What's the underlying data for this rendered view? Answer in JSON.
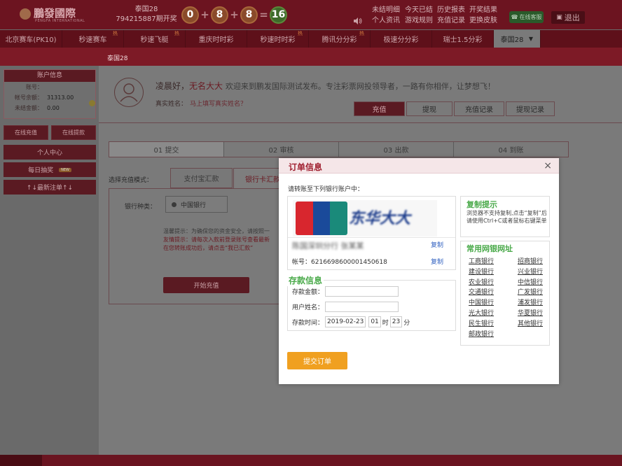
{
  "header": {
    "logo": "鵬發國際",
    "logo_sub": "PENGFA INTERNATIONAL",
    "lottery_name": "泰国28",
    "issue": "794215887期开奖",
    "balls": [
      "0",
      "8",
      "8"
    ],
    "ops": [
      "+",
      "+",
      "="
    ],
    "sum": "16",
    "links": [
      "未结明细",
      "个人资讯",
      "今天已结",
      "游戏规则",
      "历史报表",
      "充值记录",
      "开奖结果",
      "更换皮肤"
    ],
    "service": "在线客服",
    "exit": "退出"
  },
  "gamenav": [
    {
      "label": "北京赛车(PK10)",
      "hot": ""
    },
    {
      "label": "秒速赛车",
      "hot": "热"
    },
    {
      "label": "秒速飞艇",
      "hot": "热"
    },
    {
      "label": "重庆时时彩",
      "hot": ""
    },
    {
      "label": "秒速时时彩",
      "hot": "热"
    },
    {
      "label": "腾讯分分彩",
      "hot": "热"
    },
    {
      "label": "极速分分彩",
      "hot": ""
    },
    {
      "label": "瑞士1.5分彩",
      "hot": ""
    },
    {
      "label": "泰国28",
      "hot": ""
    }
  ],
  "subbar": "泰国28",
  "sidebar": {
    "account_title": "账户信息",
    "rows": [
      {
        "k": "账号：",
        "v": ""
      },
      {
        "k": "帐号余额：",
        "v": "31313.00"
      },
      {
        "k": "未结金额：",
        "v": "0.00"
      }
    ],
    "btn_recharge": "在线充值",
    "btn_withdraw": "在线提款",
    "menu": [
      "个人中心",
      "每日抽奖",
      "↑↓最新注单↑↓"
    ],
    "new_tag": "NEW"
  },
  "main": {
    "greeting": "凌晨好，",
    "username": "无名大大",
    "welcome": "欢迎来到鹏发国际测试发布。专注彩票网投领导者，一路有你相伴，让梦想飞！",
    "realname_label": "真实姓名：",
    "realname_link": "马上填写真实姓名？",
    "tabs": [
      "充值",
      "提现",
      "充值记录",
      "提现记录"
    ],
    "steps": [
      "01 提交",
      "02 审核",
      "03 出款",
      "04 到账"
    ],
    "mode_label": "选择充值模式：",
    "modes": [
      "支付宝汇款",
      "银行卡汇款"
    ],
    "bank_kind_label": "银行种类：",
    "bank_selected": "中国银行",
    "tip1": "温馨提示：为确保您的资金安全，请按照一",
    "tip2": "友情提示：请每次入款前登录账号查看最新",
    "tip3": "在您转账成功后，请点击“我已汇款”",
    "start_btn": "开始充值"
  },
  "modal": {
    "title": "订单信息",
    "close": "×",
    "transfer_label": "请转账至下列银行账户中：",
    "card_brand": "中国银联",
    "bank_text": "东华大大",
    "name_text": "陈国深圳分行  张某某",
    "copy": "复制",
    "account_label": "帐号：",
    "account_no": "6216698600001450618",
    "deposit_title": "存款信息",
    "amount_label": "存款金额：",
    "name_label": "用户姓名：",
    "time_label": "存款时间：",
    "date": "2019-02-23",
    "hour": "01",
    "hour_unit": "时",
    "minute": "23",
    "minute_unit": "分",
    "tips_title": "复制提示",
    "tips_text": "浏览器不支持复制,点击“复制”后请使用Ctrl+C或者鼠标右键菜单",
    "links_title": "常用网银网址",
    "banks": [
      "工商银行",
      "招商银行",
      "建设银行",
      "兴业银行",
      "农业银行",
      "中信银行",
      "交通银行",
      "广发银行",
      "中国银行",
      "浦发银行",
      "光大银行",
      "华夏银行",
      "民生银行",
      "其他银行",
      "邮政银行"
    ],
    "submit": "提交订单"
  }
}
